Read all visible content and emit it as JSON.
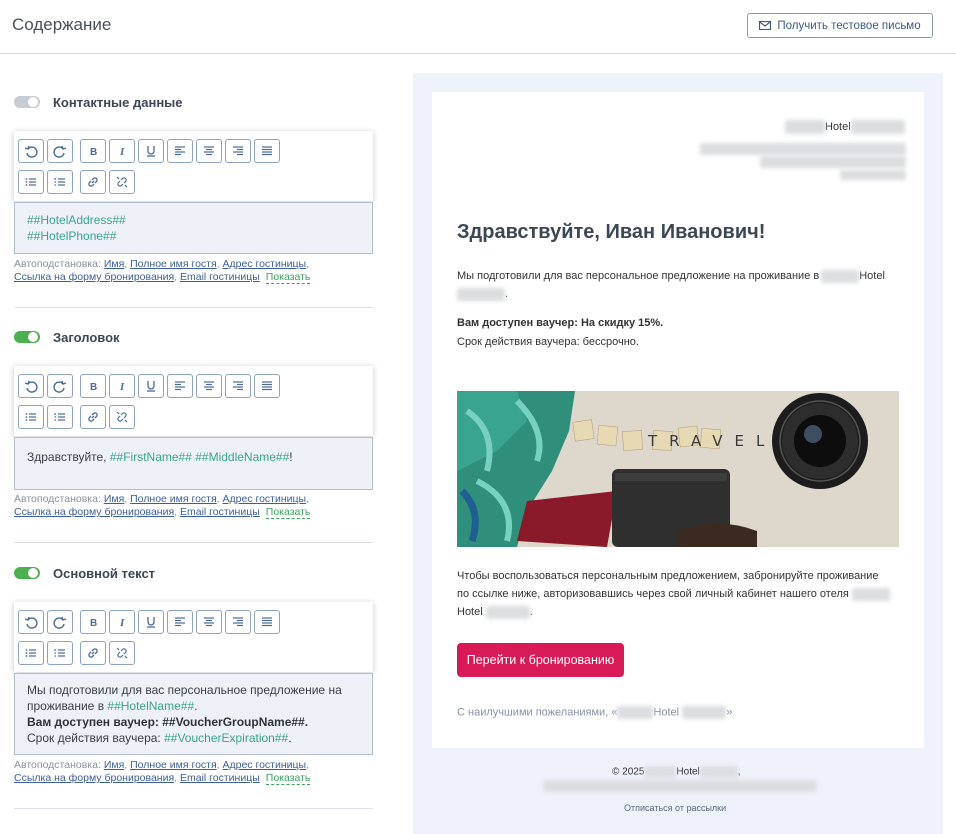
{
  "header": {
    "title": "Содержание",
    "test_button": "Получить тестовое письмо"
  },
  "sections": [
    {
      "title": "Контактные данные",
      "enabled": false,
      "editor_lines": [
        "##HotelAddress##",
        "##HotelPhone##"
      ]
    },
    {
      "title": "Заголовок",
      "enabled": true,
      "editor_prefix": "Здравствуйте, ",
      "editor_macro": "##FirstName## ##MiddleName##",
      "editor_suffix": "!"
    },
    {
      "title": "Основной текст",
      "enabled": true,
      "line1": "Мы подготовили для вас персональное предложение на",
      "line2_prefix": "проживание в ",
      "line2_macro": "##HotelName##",
      "line2_suffix": ".",
      "line3_bold": "Вам доступен ваучер: ",
      "line3_macro": "##VoucherGroupName##",
      "line3_suffix": ".",
      "line4_prefix": "Срок действия ваучера: ",
      "line4_macro": "##VoucherExpiration##",
      "line4_suffix": "."
    }
  ],
  "autosub": {
    "label": "Автоподстановка:",
    "links": [
      "Имя",
      "Полное имя гостя",
      "Адрес гостиницы",
      "Ссылка на форму бронирования",
      "Email гостиницы"
    ],
    "show": "Показать"
  },
  "toolbar_icons": [
    "undo-icon",
    "redo-icon",
    "bold-icon",
    "italic-icon",
    "underline-icon",
    "align-left-icon",
    "align-center-icon",
    "align-right-icon",
    "align-justify-icon",
    "bullet-list-icon",
    "numbered-list-icon",
    "link-icon",
    "unlink-icon"
  ],
  "email": {
    "hotel_word": "Hotel",
    "greeting": "Здравствуйте, Иван Иванович!",
    "intro": "Мы подготовили для вас персональное предложение на проживание в",
    "voucher": "Вам доступен ваучер: На скидку 15%.",
    "expiration": "Срок действия ваучера: бессрочно.",
    "photo_word": "TRAVEL",
    "cta_text_1": "Чтобы воспользоваться персональным предложением, забронируйте проживание",
    "cta_text_2": "по ссылке ниже, авторизовавшись через свой личный кабинет нашего отеля",
    "button": "Перейти к бронированию",
    "regards": "С наилучшими пожеланиями, «",
    "regards_close": "»",
    "copyright": "© 2025",
    "unsubscribe": "Отписаться от рассылки"
  },
  "colors": {
    "accent_green": "#4caf50",
    "macro": "#3aa38e",
    "cta": "#d81b56",
    "link": "#3c5f95"
  }
}
